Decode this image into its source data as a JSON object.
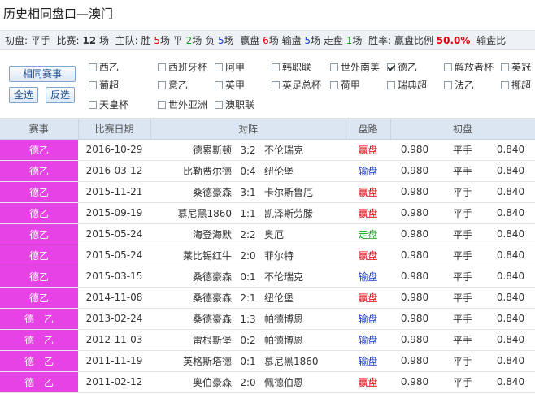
{
  "title": "历史相同盘口—澳门",
  "summary": {
    "label_init": "初盘:",
    "init_value": "平手",
    "label_matches": "比赛:",
    "matches": "12",
    "unit": "场",
    "label_role": "主队:",
    "label_win": "胜",
    "wins": "5",
    "unit_win": "场",
    "label_draw": "平",
    "draws": "2",
    "unit_draw": "场",
    "label_loss": "负",
    "losses": "5",
    "unit_loss": "场",
    "label_win_pan": "赢盘",
    "win_pan": "6",
    "unit_win_pan": "场",
    "label_lose_pan": "输盘",
    "lose_pan": "5",
    "unit_lose_pan": "场",
    "label_walk": "走盘",
    "walk": "1",
    "unit_walk": "场",
    "label_rate": "胜率:",
    "label_win_ratio": "赢盘比例",
    "win_ratio": "50.0%",
    "label_lose_ratio": "输盘比"
  },
  "buttons": {
    "same": "相同赛事",
    "all": "全选",
    "invert": "反选"
  },
  "leagues": [
    {
      "label": "西乙",
      "checked": false
    },
    {
      "label": "西班牙杯",
      "checked": false
    },
    {
      "label": "阿甲",
      "checked": false
    },
    {
      "label": "韩职联",
      "checked": false
    },
    {
      "label": "世外南美",
      "checked": false
    },
    {
      "label": "德乙",
      "checked": true
    },
    {
      "label": "解放者杯",
      "checked": false
    },
    {
      "label": "英冠",
      "checked": false
    },
    {
      "label": "葡超",
      "checked": false
    },
    {
      "label": "意乙",
      "checked": false
    },
    {
      "label": "英甲",
      "checked": false
    },
    {
      "label": "英足总杯",
      "checked": false
    },
    {
      "label": "荷甲",
      "checked": false
    },
    {
      "label": "瑞典超",
      "checked": false
    },
    {
      "label": "法乙",
      "checked": false
    },
    {
      "label": "挪超",
      "checked": false
    },
    {
      "label": "天皇杯",
      "checked": false
    },
    {
      "label": "世外亚洲",
      "checked": false
    },
    {
      "label": "澳职联",
      "checked": false
    }
  ],
  "table": {
    "headers": [
      "赛事",
      "比赛日期",
      "对阵",
      "盘路",
      "初盘"
    ],
    "rows": [
      {
        "league": "德乙",
        "date": "2016-10-29",
        "home": "德累斯顿",
        "score": "3:2",
        "away": "不伦瑞克",
        "result": "赢盘",
        "odds_home": "0.980",
        "line": "平手",
        "odds_away": "0.840"
      },
      {
        "league": "德乙",
        "date": "2016-03-12",
        "home": "比勒费尔德",
        "score": "0:4",
        "away": "纽伦堡",
        "result": "输盘",
        "odds_home": "0.980",
        "line": "平手",
        "odds_away": "0.840"
      },
      {
        "league": "德乙",
        "date": "2015-11-21",
        "home": "桑德豪森",
        "score": "3:1",
        "away": "卡尔斯鲁厄",
        "result": "赢盘",
        "odds_home": "0.980",
        "line": "平手",
        "odds_away": "0.840"
      },
      {
        "league": "德乙",
        "date": "2015-09-19",
        "home": "慕尼黑1860",
        "score": "1:1",
        "away": "凯泽斯劳滕",
        "result": "赢盘",
        "odds_home": "0.980",
        "line": "平手",
        "odds_away": "0.840"
      },
      {
        "league": "德乙",
        "date": "2015-05-24",
        "home": "海登海默",
        "score": "2:2",
        "away": "奥厄",
        "result": "走盘",
        "odds_home": "0.980",
        "line": "平手",
        "odds_away": "0.840"
      },
      {
        "league": "德乙",
        "date": "2015-05-24",
        "home": "莱比锡红牛",
        "score": "2:0",
        "away": "菲尔特",
        "result": "赢盘",
        "odds_home": "0.980",
        "line": "平手",
        "odds_away": "0.840"
      },
      {
        "league": "德乙",
        "date": "2015-03-15",
        "home": "桑德豪森",
        "score": "0:1",
        "away": "不伦瑞克",
        "result": "输盘",
        "odds_home": "0.980",
        "line": "平手",
        "odds_away": "0.840"
      },
      {
        "league": "德乙",
        "date": "2014-11-08",
        "home": "桑德豪森",
        "score": "2:1",
        "away": "纽伦堡",
        "result": "赢盘",
        "odds_home": "0.980",
        "line": "平手",
        "odds_away": "0.840"
      },
      {
        "league": "德　乙",
        "date": "2013-02-24",
        "home": "桑德豪森",
        "score": "1:3",
        "away": "帕德博恩",
        "result": "输盘",
        "odds_home": "0.980",
        "line": "平手",
        "odds_away": "0.840"
      },
      {
        "league": "德　乙",
        "date": "2012-11-03",
        "home": "雷根斯堡",
        "score": "0:2",
        "away": "帕德博恩",
        "result": "输盘",
        "odds_home": "0.980",
        "line": "平手",
        "odds_away": "0.840"
      },
      {
        "league": "德　乙",
        "date": "2011-11-19",
        "home": "英格斯塔德",
        "score": "0:1",
        "away": "慕尼黑1860",
        "result": "输盘",
        "odds_home": "0.980",
        "line": "平手",
        "odds_away": "0.840"
      },
      {
        "league": "德　乙",
        "date": "2011-02-12",
        "home": "奥伯豪森",
        "score": "2:0",
        "away": "佩德伯恩",
        "result": "赢盘",
        "odds_home": "0.980",
        "line": "平手",
        "odds_away": "0.840"
      }
    ]
  },
  "colors": {
    "league_bg": "#e642e6",
    "win": "#e0000a",
    "lose": "#1a3ad8",
    "draw": "#1a9c1a",
    "header_bg": "#dbe6f2"
  }
}
